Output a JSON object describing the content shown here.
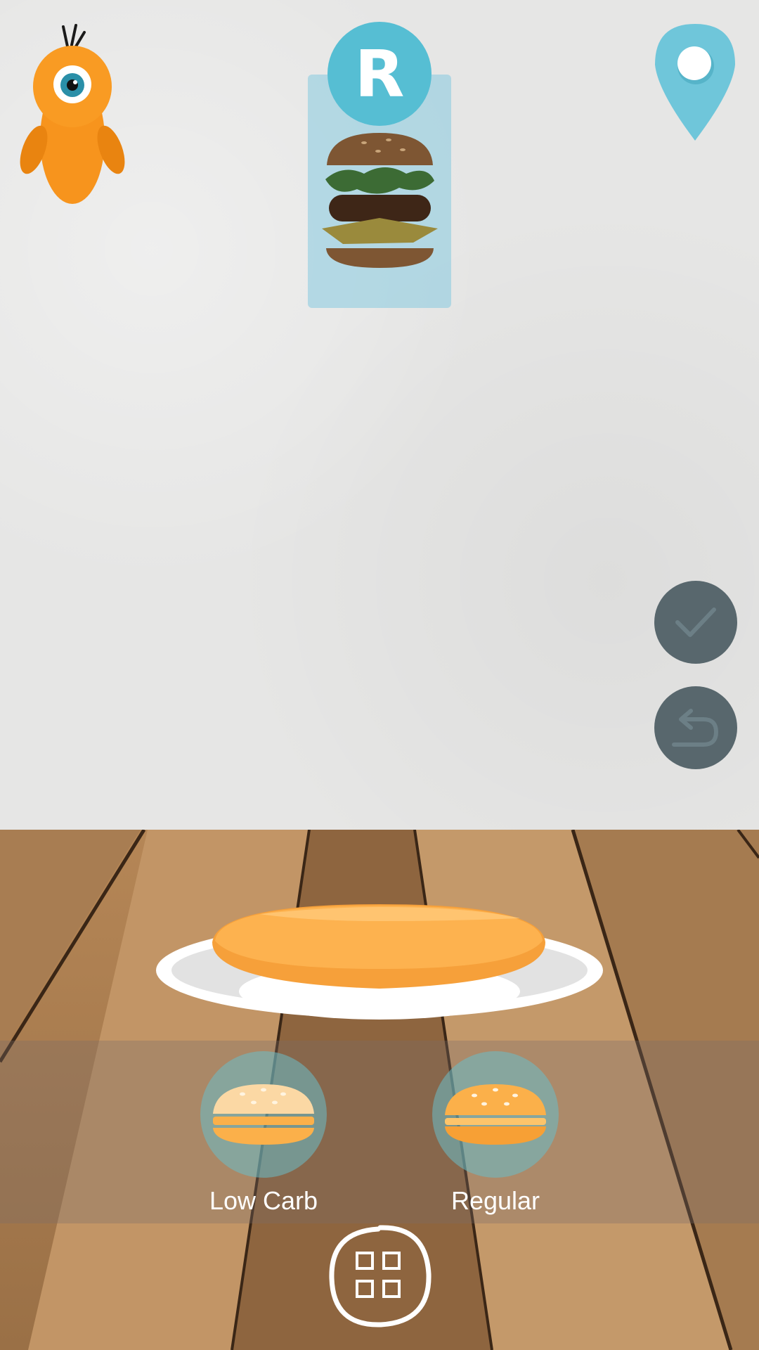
{
  "recipe": {
    "badge_letter": "R"
  },
  "options": [
    {
      "label": "Low Carb",
      "icon": "low-carb-bun-icon"
    },
    {
      "label": "Regular",
      "icon": "regular-bun-icon"
    }
  ],
  "icons": {
    "mascot": "orange-one-eyed-mascot-icon",
    "location": "location-pin-icon",
    "confirm": "checkmark-icon",
    "undo": "undo-icon",
    "menu": "grid-menu-icon"
  },
  "colors": {
    "accent_blue": "#56bed3",
    "button_gray": "#58676d",
    "bun_orange": "#fbb04a",
    "mascot_orange": "#f7941d"
  }
}
